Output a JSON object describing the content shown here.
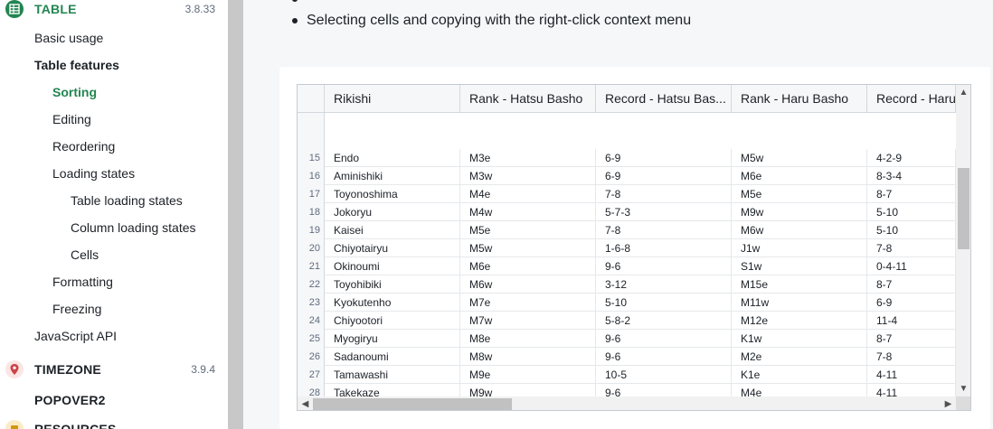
{
  "sidebar": {
    "table_section": {
      "label": "TABLE",
      "version": "3.8.33",
      "icon": "table-icon",
      "color": "#238551"
    },
    "items": [
      {
        "label": "Basic usage"
      },
      {
        "label": "Table features"
      },
      {
        "label": "Sorting"
      },
      {
        "label": "Editing"
      },
      {
        "label": "Reordering"
      },
      {
        "label": "Loading states"
      },
      {
        "label": "Table loading states"
      },
      {
        "label": "Column loading states"
      },
      {
        "label": "Cells"
      },
      {
        "label": "Formatting"
      },
      {
        "label": "Freezing"
      },
      {
        "label": "JavaScript API"
      }
    ],
    "timezone_section": {
      "label": "TIMEZONE",
      "version": "3.9.4",
      "icon": "map-marker-icon",
      "color": "#cd4246"
    },
    "popover_section": {
      "label": "POPOVER2"
    },
    "resources_section": {
      "label": "RESOURCES",
      "icon": "resources-icon",
      "color": "#d1980b"
    }
  },
  "main": {
    "bullet_text": "Selecting cells and copying with the right-click context menu"
  },
  "table": {
    "columns": [
      "Rikishi",
      "Rank - Hatsu Basho",
      "Record - Hatsu Bas...",
      "Rank - Haru Basho",
      "Record - Haru"
    ],
    "rows": [
      {
        "num": "15",
        "cells": [
          "Endo",
          "M3e",
          "6-9",
          "M5w",
          "4-2-9"
        ]
      },
      {
        "num": "16",
        "cells": [
          "Aminishiki",
          "M3w",
          "6-9",
          "M6e",
          "8-3-4"
        ]
      },
      {
        "num": "17",
        "cells": [
          "Toyonoshima",
          "M4e",
          "7-8",
          "M5e",
          "8-7"
        ]
      },
      {
        "num": "18",
        "cells": [
          "Jokoryu",
          "M4w",
          "5-7-3",
          "M9w",
          "5-10"
        ]
      },
      {
        "num": "19",
        "cells": [
          "Kaisei",
          "M5e",
          "7-8",
          "M6w",
          "5-10"
        ]
      },
      {
        "num": "20",
        "cells": [
          "Chiyotairyu",
          "M5w",
          "1-6-8",
          "J1w",
          "7-8"
        ]
      },
      {
        "num": "21",
        "cells": [
          "Okinoumi",
          "M6e",
          "9-6",
          "S1w",
          "0-4-11"
        ]
      },
      {
        "num": "22",
        "cells": [
          "Toyohibiki",
          "M6w",
          "3-12",
          "M15e",
          "8-7"
        ]
      },
      {
        "num": "23",
        "cells": [
          "Kyokutenho",
          "M7e",
          "5-10",
          "M11w",
          "6-9"
        ]
      },
      {
        "num": "24",
        "cells": [
          "Chiyootori",
          "M7w",
          "5-8-2",
          "M12e",
          "11-4"
        ]
      },
      {
        "num": "25",
        "cells": [
          "Myogiryu",
          "M8e",
          "9-6",
          "K1w",
          "8-7"
        ]
      },
      {
        "num": "26",
        "cells": [
          "Sadanoumi",
          "M8w",
          "9-6",
          "M2e",
          "7-8"
        ]
      },
      {
        "num": "27",
        "cells": [
          "Tamawashi",
          "M9e",
          "10-5",
          "K1e",
          "4-11"
        ]
      },
      {
        "num": "28",
        "cells": [
          "Takekaze",
          "M9w",
          "9-6",
          "M4e",
          "4-11"
        ]
      }
    ]
  }
}
